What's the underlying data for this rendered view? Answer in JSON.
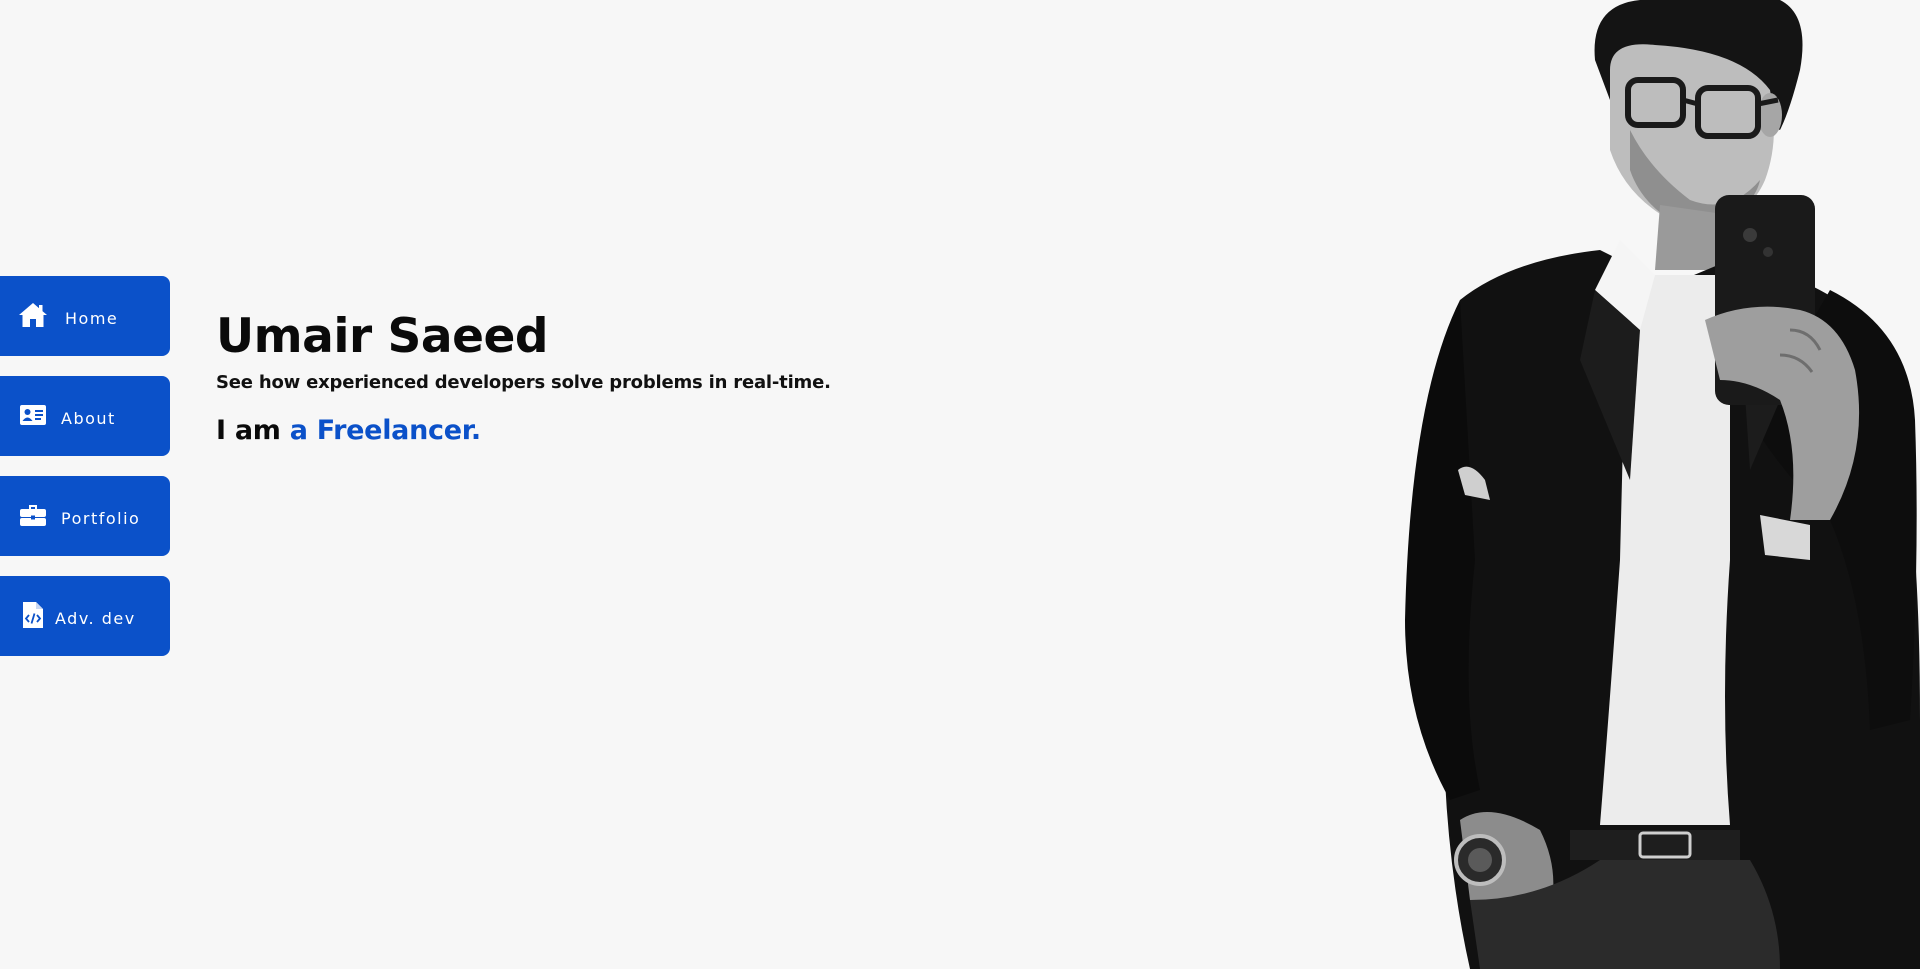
{
  "nav": {
    "items": [
      {
        "label": "Home",
        "icon": "home-icon"
      },
      {
        "label": "About",
        "icon": "id-card-icon"
      },
      {
        "label": "Portfolio",
        "icon": "briefcase-icon"
      },
      {
        "label": "Adv. dev",
        "icon": "code-file-icon"
      }
    ]
  },
  "hero": {
    "name": "Umair Saeed",
    "subtitle": "See how experienced developers solve problems in real-time.",
    "role_prefix": "I am",
    "role_accent": "a Freelancer."
  },
  "colors": {
    "accent": "#0b51c9",
    "background": "#f7f7f7",
    "text": "#0a0a0a"
  }
}
